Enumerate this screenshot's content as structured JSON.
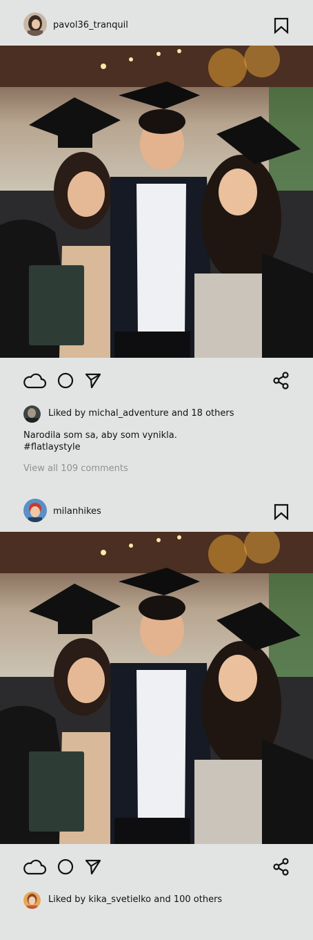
{
  "posts": [
    {
      "username": "pavol36_tranquil",
      "liked_prefix": "Liked by ",
      "liked_user": "michal_adventure",
      "liked_suffix": " and 18 others",
      "caption_line1": "Narodila som sa, aby som vynikla.",
      "caption_line2": "#flatlaystyle",
      "view_comments": "View all 109 comments"
    },
    {
      "username": "milanhikes",
      "liked_prefix": "Liked by ",
      "liked_user": "kika_svetielko",
      "liked_suffix": " and 100 others"
    }
  ],
  "icons": {
    "bookmark": "bookmark-icon",
    "like": "cloud-icon",
    "comment": "circle-icon",
    "send": "send-icon",
    "share": "share-icon"
  },
  "colors": {
    "background": "#e2e4e3",
    "text": "#111111",
    "muted": "#909090"
  }
}
